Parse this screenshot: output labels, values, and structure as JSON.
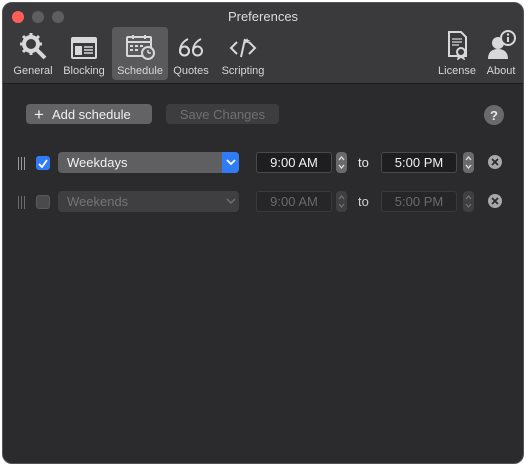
{
  "window": {
    "title": "Preferences"
  },
  "toolbar": {
    "items": [
      {
        "label": "General",
        "icon": "gear-icon",
        "active": false
      },
      {
        "label": "Blocking",
        "icon": "browser-window-icon",
        "active": false
      },
      {
        "label": "Schedule",
        "icon": "calendar-clock-icon",
        "active": true
      },
      {
        "label": "Quotes",
        "icon": "quote-icon",
        "active": false
      },
      {
        "label": "Scripting",
        "icon": "code-icon",
        "active": false
      },
      {
        "label": "License",
        "icon": "certificate-icon",
        "active": false
      },
      {
        "label": "About",
        "icon": "info-person-icon",
        "active": false
      }
    ]
  },
  "actions": {
    "add_label": "Add schedule",
    "save_label": "Save Changes",
    "help_label": "?"
  },
  "schedules": [
    {
      "enabled": true,
      "days": "Weekdays",
      "start": "9:00 AM",
      "separator": "to",
      "end": "5:00 PM"
    },
    {
      "enabled": false,
      "days": "Weekends",
      "start": "9:00 AM",
      "separator": "to",
      "end": "5:00 PM"
    }
  ],
  "colors": {
    "accent": "#2f7cf6",
    "close": "#ff5f57",
    "window_bg": "#2b2b2d"
  }
}
